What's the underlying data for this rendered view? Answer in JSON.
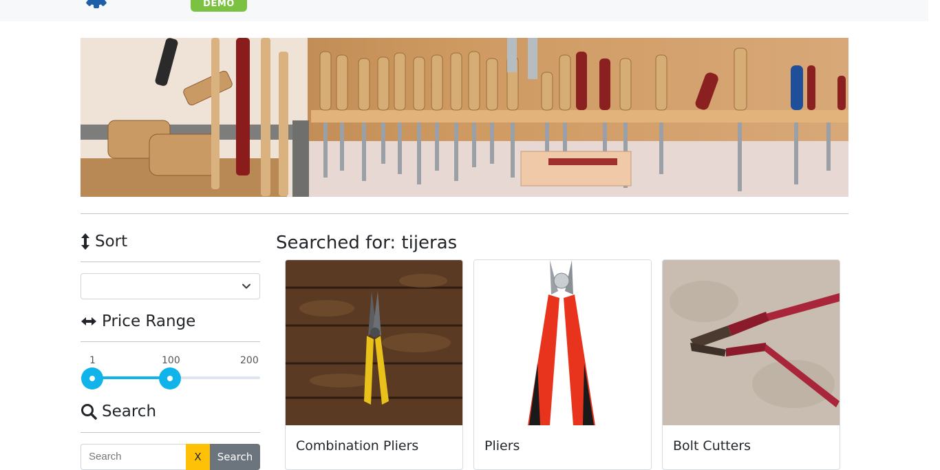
{
  "header": {
    "badge": "DEMO",
    "logo_icon": "gear-icon"
  },
  "banner": {
    "image": "workshop-tools-banner"
  },
  "sidebar": {
    "sort": {
      "icon": "vertical-arrows-icon",
      "title": "Sort",
      "selected": ""
    },
    "price_range": {
      "icon": "horizontal-arrows-icon",
      "title": "Price Range",
      "min_label": "1",
      "current_label": "100",
      "max_label": "200",
      "low_value": 1,
      "high_value": 100,
      "max_value": 200
    },
    "search": {
      "icon": "search-icon",
      "title": "Search",
      "placeholder": "Search",
      "clear_label": "X",
      "button_label": "Search"
    }
  },
  "results": {
    "title": "Searched for: tijeras",
    "products": [
      {
        "name": "Combination Pliers",
        "image": "combination-pliers-image"
      },
      {
        "name": "Pliers",
        "image": "pliers-image"
      },
      {
        "name": "Bolt Cutters",
        "image": "bolt-cutters-image"
      }
    ]
  },
  "colors": {
    "accent": "#10b4ea",
    "badge": "#7cc242",
    "clear_button": "#ffc107",
    "search_button": "#6c757d",
    "logo": "#1e5fa8"
  }
}
